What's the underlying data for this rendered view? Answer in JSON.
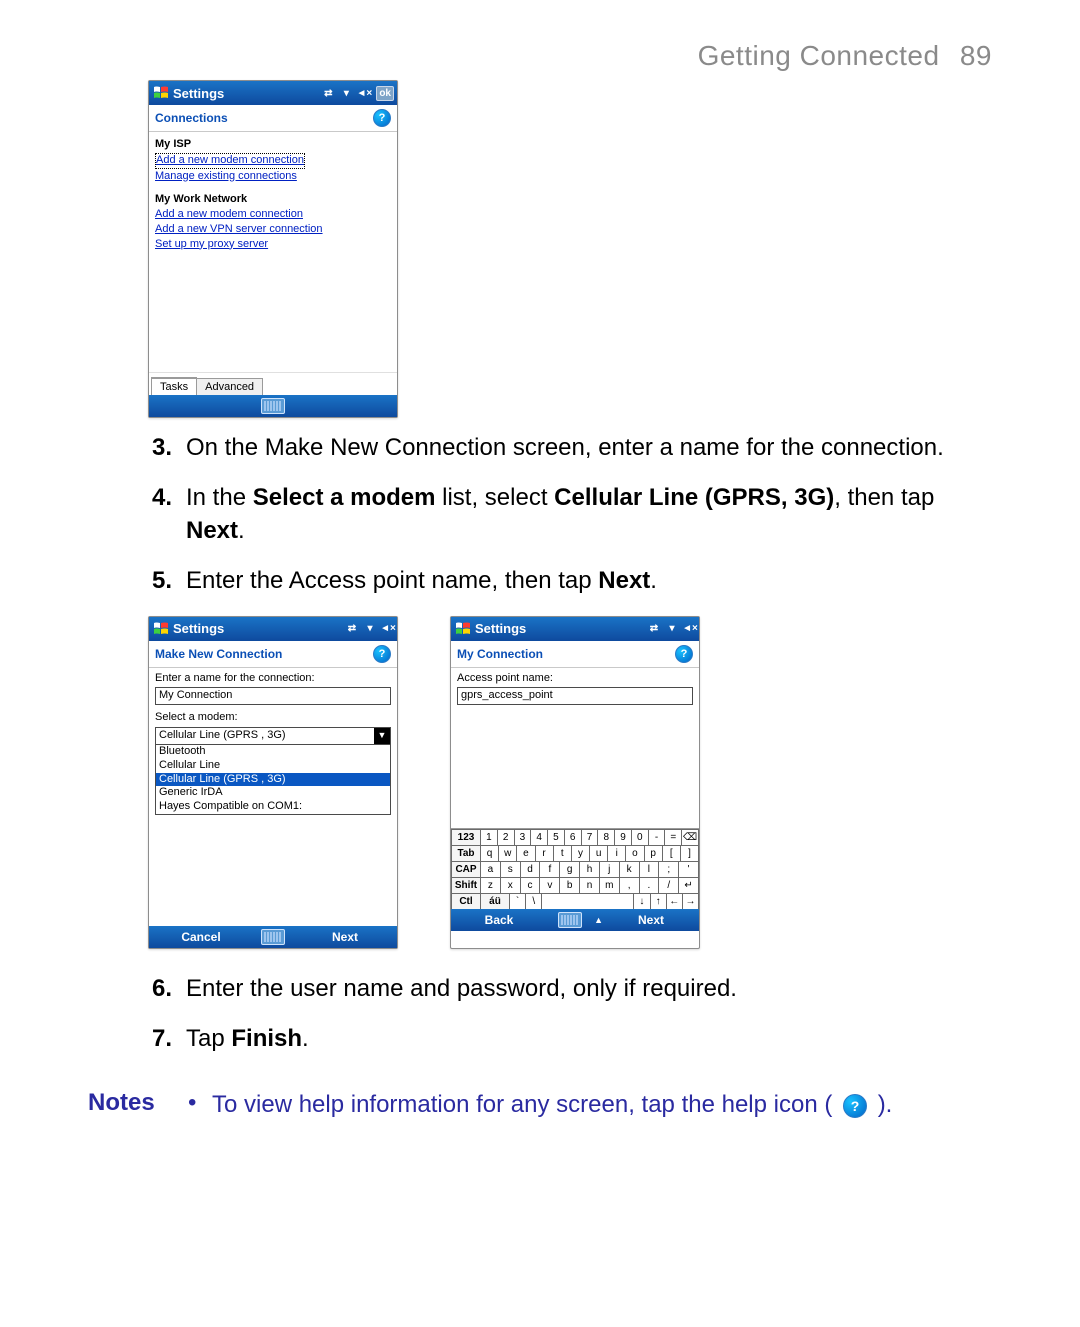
{
  "header": {
    "title": "Getting Connected",
    "page_number": "89"
  },
  "screen1": {
    "title": "Settings",
    "ok": "ok",
    "sub": "Connections",
    "isp_title": "My ISP",
    "isp_link1": "Add a new modem connection",
    "isp_link2": "Manage existing connections",
    "work_title": "My Work Network",
    "work_link1": "Add a new modem connection",
    "work_link2": "Add a new VPN server connection",
    "work_link3": "Set up my proxy server",
    "tab1": "Tasks",
    "tab2": "Advanced"
  },
  "steps_a": [
    {
      "num": "3.",
      "html": "On the Make New Connection screen, enter a name for the connection."
    },
    {
      "num": "4.",
      "html": "In the <b>Select a modem</b> list, select <b>Cellular Line (GPRS, 3G)</b>, then tap <b>Next</b>."
    },
    {
      "num": "5.",
      "html": "Enter the Access point name, then tap <b>Next</b>."
    }
  ],
  "screen2": {
    "title": "Settings",
    "sub": "Make New Connection",
    "label_name": "Enter a name for the connection:",
    "value_name": "My Connection",
    "label_modem": "Select a modem:",
    "value_modem": "Cellular Line (GPRS , 3G)",
    "options": [
      "Bluetooth",
      "Cellular Line",
      "Cellular Line (GPRS , 3G)",
      "Generic IrDA",
      "Hayes Compatible on COM1:"
    ],
    "foot_left": "Cancel",
    "foot_right": "Next"
  },
  "screen3": {
    "title": "Settings",
    "sub": "My Connection",
    "label_apn": "Access point name:",
    "value_apn": "gprs_access_point",
    "foot_left": "Back",
    "foot_right": "Next",
    "osk": {
      "r1": [
        "123",
        "1",
        "2",
        "3",
        "4",
        "5",
        "6",
        "7",
        "8",
        "9",
        "0",
        "-",
        "=",
        "⌫"
      ],
      "r2": [
        "Tab",
        "q",
        "w",
        "e",
        "r",
        "t",
        "y",
        "u",
        "i",
        "o",
        "p",
        "[",
        "]"
      ],
      "r3": [
        "CAP",
        "a",
        "s",
        "d",
        "f",
        "g",
        "h",
        "j",
        "k",
        "l",
        ";",
        "'"
      ],
      "r4": [
        "Shift",
        "z",
        "x",
        "c",
        "v",
        "b",
        "n",
        "m",
        ",",
        ".",
        "/",
        "↵"
      ],
      "r5": [
        "Ctl",
        "áü",
        "`",
        "\\",
        " ",
        "↓",
        "↑",
        "←",
        "→"
      ]
    }
  },
  "steps_b": [
    {
      "num": "6.",
      "html": "Enter the user name and password, only if required."
    },
    {
      "num": "7.",
      "html": "Tap <b>Finish</b>."
    }
  ],
  "notes": {
    "label": "Notes",
    "bullet": "•",
    "text_before": "To view help information for any screen, tap the help icon (",
    "text_after": ")."
  }
}
